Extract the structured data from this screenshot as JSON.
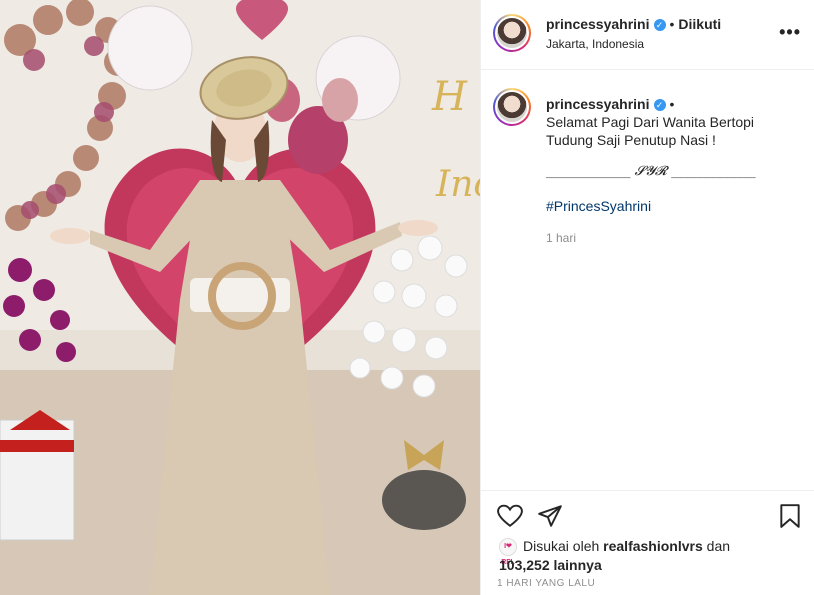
{
  "header": {
    "username": "princessyahrini",
    "follow_status": "Diikuti",
    "location": "Jakarta, Indonesia",
    "more_icon": "more-horizontal-icon"
  },
  "caption": {
    "username": "princessyahrini",
    "line1": "Selamat Pagi Dari Wanita Bertopi",
    "line2": "Tudung Saji Penutup Nasi !",
    "signature": "_____________ 𝓢𝓨𝓡 _____________",
    "hashtag": "#PrincesSyahrini",
    "time": "1 hari"
  },
  "actions": {
    "liked_by_prefix": "Disukai oleh",
    "liked_by_user": "realfashionlvrs",
    "liked_by_and": "dan",
    "likes_count": "103,252 lainnya",
    "post_time": "1 HARI YANG LALU",
    "mini_avatar_text": "I❤RFL"
  },
  "colors": {
    "link": "#00376b",
    "verified": "#3897f0",
    "muted": "#8e8e8e"
  }
}
